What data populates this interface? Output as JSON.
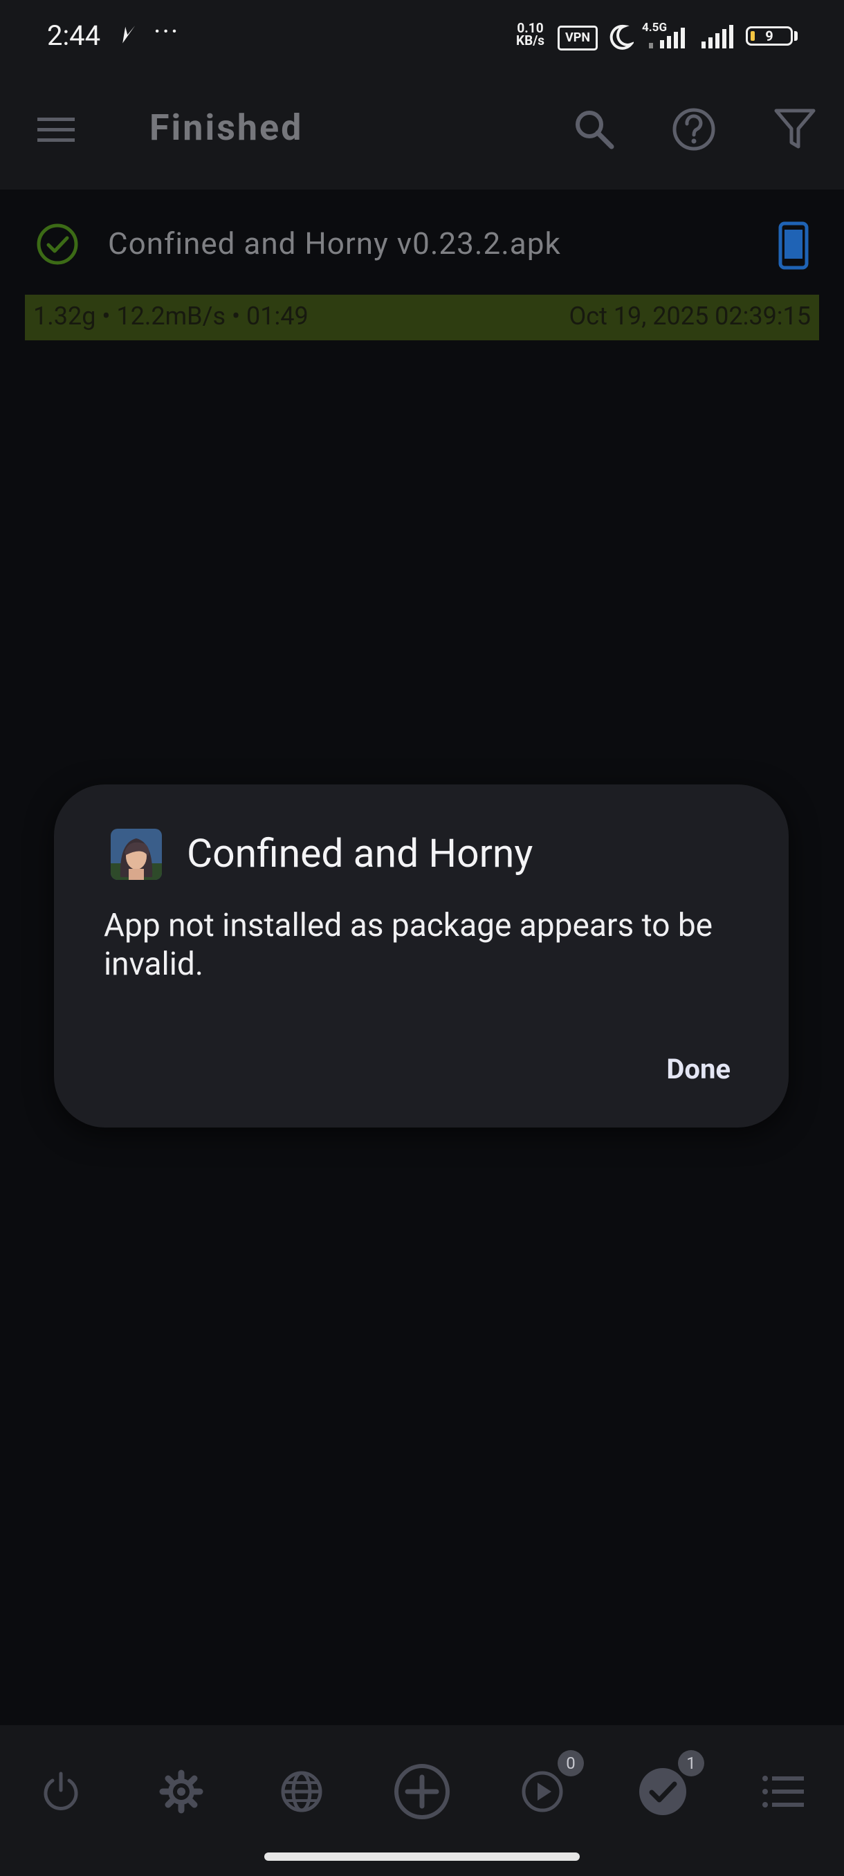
{
  "status_bar": {
    "time": "2:44",
    "speed_value": "0.10",
    "speed_unit": "KB/s",
    "vpn": "VPN",
    "network": "4.5G",
    "battery": "9"
  },
  "app_bar": {
    "title": "Finished",
    "icons": [
      "menu-icon",
      "search-icon",
      "help-icon",
      "filter-icon"
    ]
  },
  "download": {
    "name": "Confined and Horny v0.23.2.apk",
    "stats": "1.32g • 12.2mB/s • 01:49",
    "date": "Oct 19, 2025 02:39:15",
    "progress": 1.0
  },
  "dialog": {
    "title": "Confined and Horny",
    "message": "App not installed as package appears to be invalid.",
    "done_label": "Done"
  },
  "bottom_nav": {
    "items": [
      "power-icon",
      "settings-icon",
      "browser-icon",
      "add-icon",
      "active-icon",
      "finished-icon",
      "list-icon"
    ],
    "active_badge": "0",
    "finished_badge": "1"
  },
  "colors": {
    "background": "#0b0c0f",
    "bar": "#16171a",
    "dialog": "#1d1e23",
    "progress": "#2e3d11",
    "accent_blue": "#1f63b5"
  }
}
